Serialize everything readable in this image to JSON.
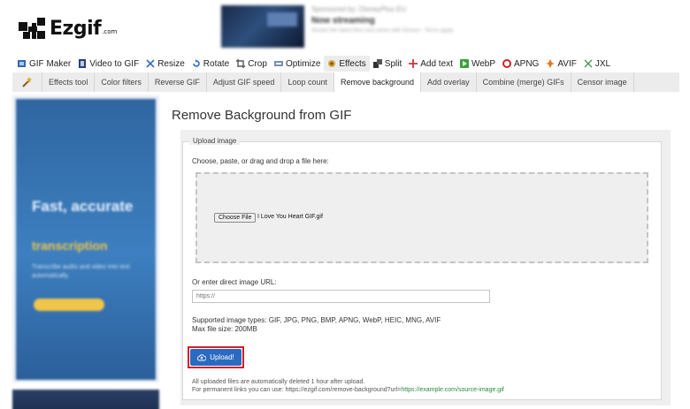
{
  "header": {
    "logo_text": "Ezgif",
    "logo_suffix": ".com",
    "ad": {
      "sponsor": "Sponsored by: DisneyPlus EU",
      "title": "Now streaming",
      "description": "Stream the latest films and series with Disney+. Terms apply."
    }
  },
  "main_nav": [
    {
      "label": "GIF Maker",
      "icon": "gif-maker-icon"
    },
    {
      "label": "Video to GIF",
      "icon": "video-icon"
    },
    {
      "label": "Resize",
      "icon": "resize-icon"
    },
    {
      "label": "Rotate",
      "icon": "rotate-icon"
    },
    {
      "label": "Crop",
      "icon": "crop-icon"
    },
    {
      "label": "Optimize",
      "icon": "optimize-icon"
    },
    {
      "label": "Effects",
      "icon": "effects-icon",
      "active": true
    },
    {
      "label": "Split",
      "icon": "split-icon"
    },
    {
      "label": "Add text",
      "icon": "add-text-icon"
    },
    {
      "label": "WebP",
      "icon": "webp-icon"
    },
    {
      "label": "APNG",
      "icon": "apng-icon"
    },
    {
      "label": "AVIF",
      "icon": "avif-icon"
    },
    {
      "label": "JXL",
      "icon": "jxl-icon"
    }
  ],
  "sub_nav": [
    {
      "label": "Effects tool"
    },
    {
      "label": "Color filters"
    },
    {
      "label": "Reverse GIF"
    },
    {
      "label": "Adjust GIF speed"
    },
    {
      "label": "Loop count"
    },
    {
      "label": "Remove background",
      "active": true
    },
    {
      "label": "Add overlay"
    },
    {
      "label": "Combine (merge) GIFs"
    },
    {
      "label": "Censor image"
    }
  ],
  "side_ad": {
    "title": "Fast, accurate",
    "highlight": "transcription",
    "text": "Transcribe audio and video into text automatically."
  },
  "main": {
    "title": "Remove Background from GIF",
    "legend": "Upload image",
    "choose_label": "Choose, paste, or drag and drop a file here:",
    "file_button": "Choose File",
    "file_name": "I Love You Heart GIF.gif",
    "url_label": "Or enter direct image URL:",
    "url_placeholder": "https://",
    "supported_types": "Supported image types: GIF, JPG, PNG, BMP, APNG, WebP, HEIC, MNG, AVIF",
    "max_size": "Max file size: 200MB",
    "upload_label": "Upload!",
    "note_delete": "All uploaded files are automatically deleted 1 hour after upload.",
    "note_permalink_prefix": "For permanent links you can use: https://ezgif.com/remove-background?url=",
    "note_permalink_example": "https://example.com/source-image.gif"
  },
  "colors": {
    "upload_button": "#2a6bc0",
    "upload_highlight": "#d0202a",
    "link_green": "#2a8a3a",
    "subnav_bg": "#ececec"
  }
}
